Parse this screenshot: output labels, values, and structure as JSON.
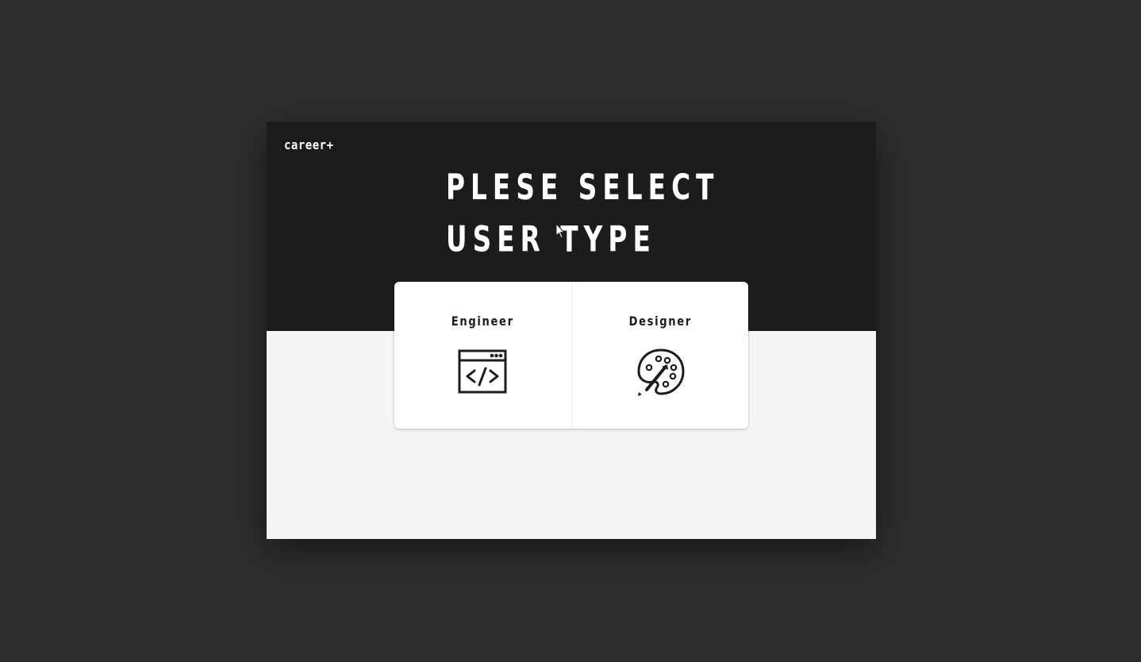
{
  "app": {
    "logo": "career+"
  },
  "hero": {
    "title_line1": "PLESE SELECT",
    "title_line2": "USER TYPE"
  },
  "user_types": [
    {
      "label": "Engineer",
      "icon": "code-window-icon"
    },
    {
      "label": "Designer",
      "icon": "paint-palette-icon"
    }
  ],
  "colors": {
    "backdrop": "#2d2d2d",
    "hero_background": "#1c1c1c",
    "page_background": "#f5f5f5",
    "card_background": "#ffffff",
    "text_light": "#ffffff",
    "text_dark": "#1c1c1c"
  }
}
